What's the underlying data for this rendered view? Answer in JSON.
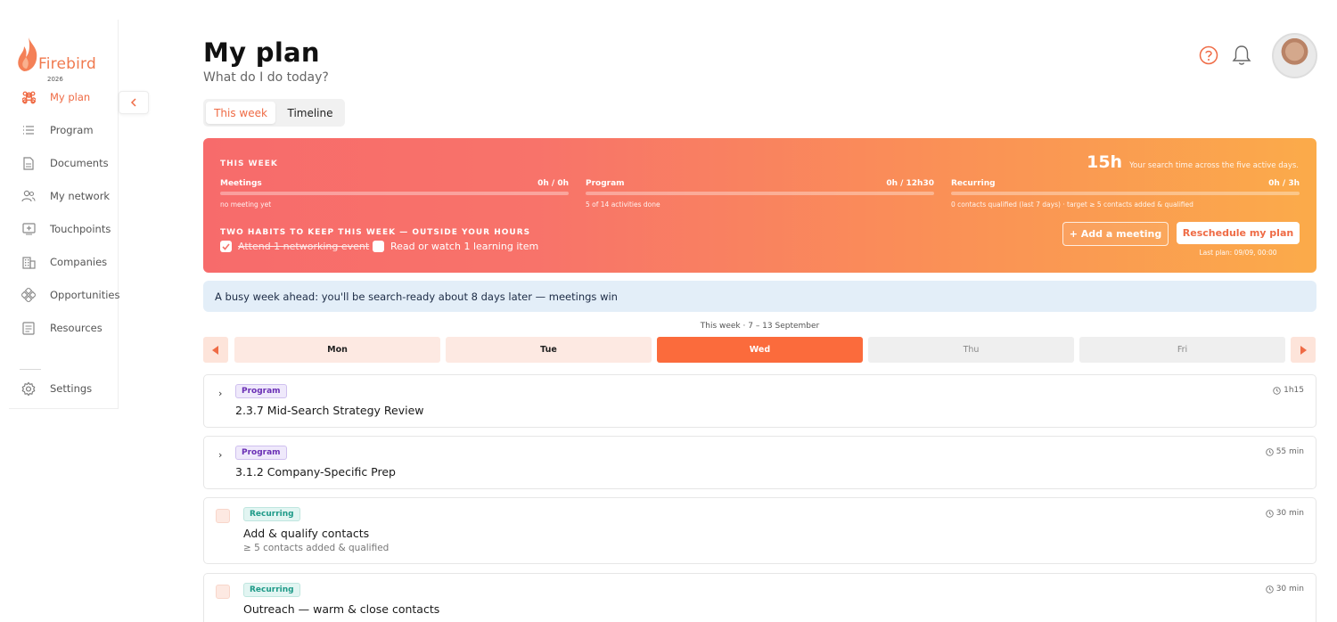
{
  "brand": {
    "name": "Firebird",
    "year": "2026"
  },
  "sidebar": {
    "items": [
      {
        "label": "My plan",
        "icon": "command-icon"
      },
      {
        "label": "Program",
        "icon": "list-icon"
      },
      {
        "label": "Documents",
        "icon": "document-icon"
      },
      {
        "label": "My network",
        "icon": "people-icon"
      },
      {
        "label": "Touchpoints",
        "icon": "add-box-icon"
      },
      {
        "label": "Companies",
        "icon": "building-icon"
      },
      {
        "label": "Opportunities",
        "icon": "diamond-icon"
      },
      {
        "label": "Resources",
        "icon": "resources-icon"
      }
    ],
    "settings": {
      "label": "Settings",
      "icon": "gear-icon"
    }
  },
  "header": {
    "title": "My plan",
    "subtitle": "What do I do today?"
  },
  "tabs": [
    {
      "label": "This week"
    },
    {
      "label": "Timeline"
    }
  ],
  "banner": {
    "eyebrow": "THIS WEEK",
    "hours": "15h",
    "hours_note": "Your search time across the five active days.",
    "metrics": [
      {
        "name": "Meetings",
        "value": "0h / 0h",
        "note": "no meeting yet",
        "progress": 0
      },
      {
        "name": "Program",
        "value": "0h / 12h30",
        "note": "5 of 14 activities done",
        "progress": 0
      },
      {
        "name": "Recurring",
        "value": "0h / 3h",
        "note": "0 contacts qualified (last 7 days) · target ≥ 5 contacts added & qualified",
        "progress": 0
      }
    ],
    "habits_title": "TWO HABITS TO KEEP THIS WEEK — OUTSIDE YOUR HOURS",
    "habits": [
      {
        "label": "Attend 1 networking event",
        "done": true
      },
      {
        "label": "Read or watch 1 learning item",
        "done": false
      }
    ],
    "add_meeting": "+ Add a meeting",
    "reschedule": "Reschedule my plan",
    "last_plan": "Last plan: 09/09, 00:00"
  },
  "info": "A busy week ahead: you'll be search-ready about 8 days later — meetings win",
  "week": {
    "label": "This week · 7 – 13 September",
    "days": [
      "Mon",
      "Tue",
      "Wed",
      "Thu",
      "Fri"
    ],
    "selected": "Wed"
  },
  "tasks": [
    {
      "tag": "Program",
      "title": "2.3.7 Mid-Search Strategy Review",
      "duration": "1h15"
    },
    {
      "tag": "Program",
      "title": "3.1.2 Company-Specific Prep",
      "duration": "55 min"
    },
    {
      "tag": "Recurring",
      "title": "Add & qualify contacts",
      "subtitle": "≥ 5 contacts added & qualified",
      "duration": "30 min"
    },
    {
      "tag": "Recurring",
      "title": "Outreach — warm & close contacts",
      "duration": "30 min"
    }
  ],
  "colors": {
    "accent": "#ef6b45",
    "today": "#fb6b3c",
    "program_tag": "#6a2fb5",
    "recurring_tag": "#1e9a88"
  }
}
